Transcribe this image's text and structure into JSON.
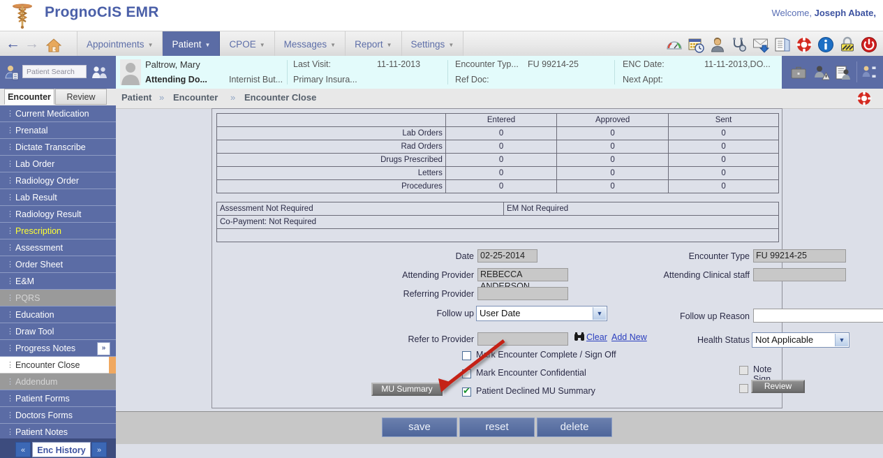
{
  "brand": {
    "title": "PrognoCIS EMR",
    "logo_icon": "caduceus-icon",
    "welcome_prefix": "Welcome, ",
    "welcome_user": "Joseph Abate,"
  },
  "menubar": {
    "back_icon": "back-arrow-icon",
    "forward_icon": "forward-arrow-icon",
    "home_icon": "home-icon",
    "items": [
      {
        "label": "Appointments",
        "has_caret": true,
        "active": false
      },
      {
        "label": "Patient",
        "has_caret": true,
        "active": true
      },
      {
        "label": "CPOE",
        "has_caret": true,
        "active": false
      },
      {
        "label": "Messages",
        "has_caret": true,
        "active": false
      },
      {
        "label": "Report",
        "has_caret": true,
        "active": false
      },
      {
        "label": "Settings",
        "has_caret": true,
        "active": false
      }
    ],
    "icons": [
      "dashboard-gauge-icon",
      "calendar-clock-icon",
      "patient-person-icon",
      "stethoscope-icon",
      "inbox-download-icon",
      "documents-icon",
      "lifebuoy-help-icon",
      "info-icon",
      "lock-icon",
      "power-logout-icon"
    ]
  },
  "patient_bar": {
    "search_placeholder": "Patient Search",
    "search_value": "",
    "search_person_icon": "person-search-icon",
    "people_icon": "people-icon",
    "avatar_icon": "patient-avatar-icon",
    "patient_name": "Paltrow, Mary",
    "attending_label": "Attending Do...",
    "attending_value": "Internist But...",
    "last_visit_label": "Last Visit:",
    "last_visit_value": "11-11-2013",
    "primary_insurance_label": "Primary Insura...",
    "encounter_type_label": "Encounter Typ...",
    "encounter_type_value": "FU 99214-25",
    "ref_doc_label": "Ref Doc:",
    "enc_date_label": "ENC Date:",
    "enc_date_value": "11-11-2013,DO...",
    "next_appt_label": "Next Appt:",
    "right_icons": [
      "briefcase-icon",
      "patient-alert-icon",
      "patient-notes-icon",
      "patient-network-icon"
    ]
  },
  "sidebar": {
    "tabs": [
      {
        "label": "Encounter",
        "selected": true
      },
      {
        "label": "Review",
        "selected": false
      }
    ],
    "items": [
      {
        "label": "Current Medication",
        "state": "normal"
      },
      {
        "label": "Prenatal",
        "state": "normal"
      },
      {
        "label": "Dictate Transcribe",
        "state": "normal"
      },
      {
        "label": "Lab Order",
        "state": "normal"
      },
      {
        "label": "Radiology Order",
        "state": "normal"
      },
      {
        "label": "Lab Result",
        "state": "normal"
      },
      {
        "label": "Radiology Result",
        "state": "normal"
      },
      {
        "label": "Prescription",
        "state": "highlight"
      },
      {
        "label": "Assessment",
        "state": "normal"
      },
      {
        "label": "Order Sheet",
        "state": "normal"
      },
      {
        "label": "E&M",
        "state": "normal"
      },
      {
        "label": "PQRS",
        "state": "disabled"
      },
      {
        "label": "Education",
        "state": "normal"
      },
      {
        "label": "Draw Tool",
        "state": "normal"
      },
      {
        "label": "Progress Notes",
        "state": "normal",
        "chevron": "»"
      },
      {
        "label": "Encounter Close",
        "state": "current"
      },
      {
        "label": "Addendum",
        "state": "disabled"
      },
      {
        "label": "Patient Forms",
        "state": "normal"
      },
      {
        "label": "Doctors Forms",
        "state": "normal"
      },
      {
        "label": "Patient Notes",
        "state": "normal"
      }
    ],
    "enc_history": {
      "label": "Enc History",
      "prev_icon": "«",
      "next_icon": "»"
    },
    "accent_color": "#f0a860"
  },
  "content": {
    "breadcrumb": [
      "Patient",
      "Encounter",
      "Encounter Close"
    ],
    "breadcrumb_separator": "»",
    "help_icon": "lifebuoy-help-icon"
  },
  "summary_table": {
    "headers": [
      "",
      "Entered",
      "Approved",
      "Sent"
    ],
    "rows": [
      {
        "label": "Lab Orders",
        "entered": "0",
        "approved": "0",
        "sent": "0"
      },
      {
        "label": "Rad Orders",
        "entered": "0",
        "approved": "0",
        "sent": "0"
      },
      {
        "label": "Drugs Prescribed",
        "entered": "0",
        "approved": "0",
        "sent": "0"
      },
      {
        "label": "Letters",
        "entered": "0",
        "approved": "0",
        "sent": "0"
      },
      {
        "label": "Procedures",
        "entered": "0",
        "approved": "0",
        "sent": "0"
      }
    ]
  },
  "requirement_table": {
    "assessment": "Assessment Not Required",
    "em": "EM Not Required",
    "copayment": "Co-Payment: Not Required",
    "blank": ""
  },
  "form": {
    "date_label": "Date",
    "date_value": "02-25-2014",
    "attending_provider_label": "Attending Provider",
    "attending_provider_value": "REBECCA ANDERSON",
    "referring_provider_label": "Referring Provider",
    "referring_provider_value": "",
    "follow_up_label": "Follow up",
    "follow_up_value": "User Date",
    "refer_to_provider_label": "Refer to Provider",
    "refer_to_provider_value": "",
    "clear_link": "Clear",
    "add_new_link": "Add New",
    "encounter_type_label": "Encounter Type",
    "encounter_type_value": "FU 99214-25",
    "attending_clinical_staff_label": "Attending Clinical staff",
    "attending_clinical_staff_value": "",
    "follow_up_reason_label": "Follow up Reason",
    "follow_up_reason_value": "",
    "health_status_label": "Health Status",
    "health_status_value": "Not Applicable",
    "binocular_icon": "binoculars-search-icon",
    "dropdown_icon": "chevron-down-icon",
    "checkboxes": [
      {
        "label": "Mark Encounter Complete / Sign Off",
        "checked": false
      },
      {
        "label": "Mark Encounter Confidential",
        "checked": false
      },
      {
        "label": "Patient Declined MU Summary",
        "checked": true
      },
      {
        "label": "Note Sign Off",
        "checked": false
      }
    ],
    "mu_summary_button": "MU Summary",
    "review_button": "Review",
    "review_checkbox_checked": false,
    "clipboard_icon": "clipboard-notes-icon",
    "annotation_arrow": "red-arrow-annotation"
  },
  "actions": {
    "save": "save",
    "reset": "reset",
    "delete": "delete"
  },
  "colors": {
    "brand_blue": "#4a5fa8",
    "navy": "#5b6ca5",
    "accent_orange": "#f0a860",
    "panel_bg": "#dde0e9",
    "highlight_yellow": "#ffff33",
    "annotation_red": "#c42015"
  }
}
